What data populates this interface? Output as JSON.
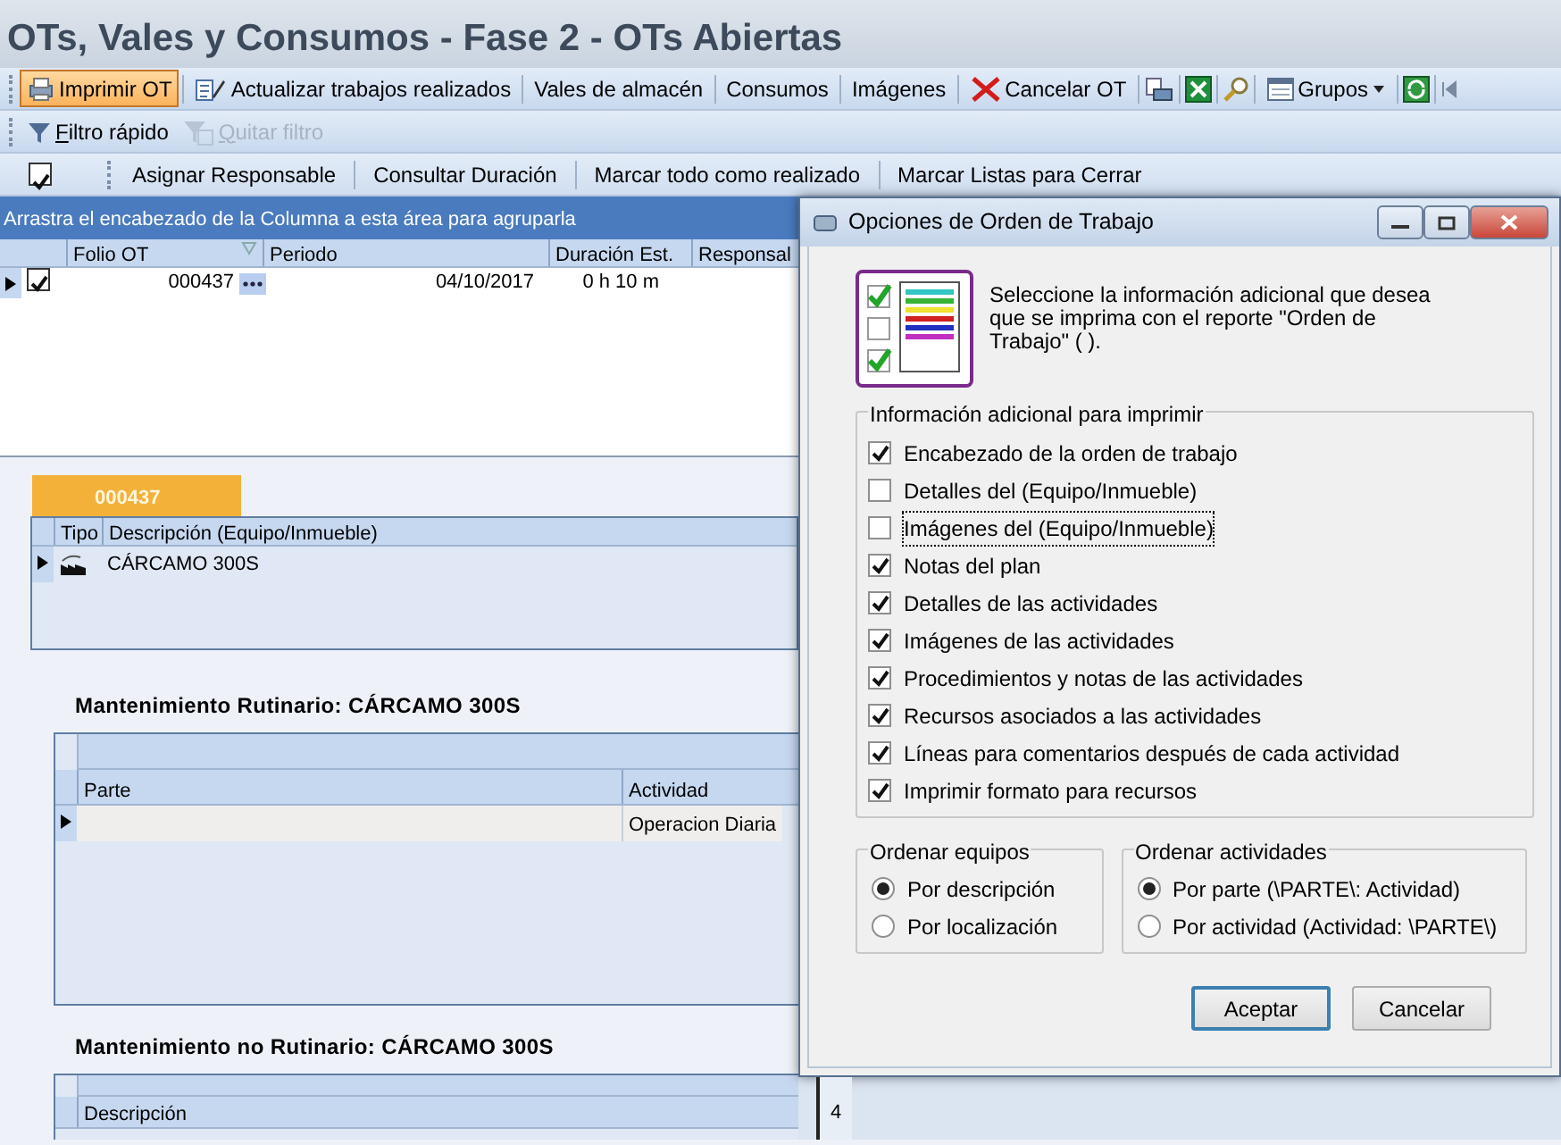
{
  "window": {
    "title": "OTs, Vales y Consumos - Fase 2 - OTs Abiertas"
  },
  "main_toolbar": [
    {
      "kind": "print",
      "label": "Imprimir OT",
      "highlighted": true
    },
    {
      "kind": "update",
      "label": "Actualizar trabajos realizados",
      "highlighted": false
    },
    {
      "kind": "text",
      "label": "Vales de almacén",
      "highlighted": false
    },
    {
      "kind": "text",
      "label": "Consumos",
      "highlighted": false
    },
    {
      "kind": "text",
      "label": "Imágenes",
      "highlighted": false
    },
    {
      "kind": "cancel",
      "label": "Cancelar OT",
      "highlighted": false
    },
    {
      "kind": "groups",
      "label": "Grupos",
      "highlighted": false
    }
  ],
  "filter_toolbar": [
    {
      "kind": "filter",
      "label": "Filtro rápido",
      "disabled": false
    },
    {
      "kind": "unfilter",
      "label": "Quitar filtro",
      "disabled": true
    }
  ],
  "action_toolbar": {
    "checked": true,
    "buttons": [
      "Asignar Responsable",
      "Consultar Duración",
      "Marcar todo como realizado",
      "Marcar Listas para Cerrar"
    ]
  },
  "group_panel": {
    "hint": "Arrastra el encabezado de la Columna a esta área para agruparla"
  },
  "orders_table": {
    "columns": [
      "Folio OT",
      "Periodo",
      "Duración Est.",
      "Responsal"
    ],
    "rows": [
      {
        "current": true,
        "checked": true,
        "folio": "000437",
        "periodo": "04/10/2017",
        "duracion": "0 h 10 m"
      }
    ]
  },
  "detail_tab": {
    "label": "000437"
  },
  "equipment_table": {
    "columns": [
      "Tipo",
      "Descripción (Equipo/Inmueble)"
    ],
    "rows": [
      {
        "current": true,
        "descripcion": "CÁRCAMO 300S"
      }
    ]
  },
  "routine": {
    "title": "Mantenimiento Rutinario: CÁRCAMO 300S",
    "columns": [
      "Parte",
      "Actividad"
    ],
    "rows": [
      {
        "current": true,
        "actividad": "Operacion Diaria"
      }
    ]
  },
  "non_routine": {
    "title": "Mantenimiento no Rutinario: CÁRCAMO 300S",
    "columns": [
      "Descripción"
    ]
  },
  "side_cell": "4",
  "dialog": {
    "title": "Opciones de Orden de Trabajo",
    "intro": "Seleccione la información adicional que desea que se imprima con el reporte \"Orden de Trabajo\" ( ).",
    "options_group": {
      "legend": "Información adicional para imprimir",
      "options": [
        {
          "label": "Encabezado de la orden de trabajo",
          "checked": true,
          "focused": false
        },
        {
          "label": "Detalles del (Equipo/Inmueble)",
          "checked": false,
          "focused": false
        },
        {
          "label": "Imágenes del (Equipo/Inmueble)",
          "checked": false,
          "focused": true
        },
        {
          "label": "Notas del plan",
          "checked": true,
          "focused": false
        },
        {
          "label": "Detalles de las actividades",
          "checked": true,
          "focused": false
        },
        {
          "label": "Imágenes de las actividades",
          "checked": true,
          "focused": false
        },
        {
          "label": "Procedimientos y notas de las actividades",
          "checked": true,
          "focused": false
        },
        {
          "label": "Recursos asociados a las actividades",
          "checked": true,
          "focused": false
        },
        {
          "label": "Líneas para comentarios después de cada actividad",
          "checked": true,
          "focused": false
        },
        {
          "label": "Imprimir formato para recursos",
          "checked": true,
          "focused": false
        }
      ]
    },
    "sort_groups": [
      {
        "legend": "Ordenar equipos",
        "options": [
          {
            "label": "Por descripción",
            "selected": true
          },
          {
            "label": "Por localización",
            "selected": false
          }
        ]
      },
      {
        "legend": "Ordenar actividades",
        "options": [
          {
            "label": "Por parte (\\PARTE\\: Actividad)",
            "selected": true
          },
          {
            "label": "Por actividad (Actividad: \\PARTE\\)",
            "selected": false
          }
        ]
      }
    ],
    "buttons": [
      {
        "label": "Aceptar",
        "default": true
      },
      {
        "label": "Cancelar",
        "default": false
      }
    ]
  }
}
